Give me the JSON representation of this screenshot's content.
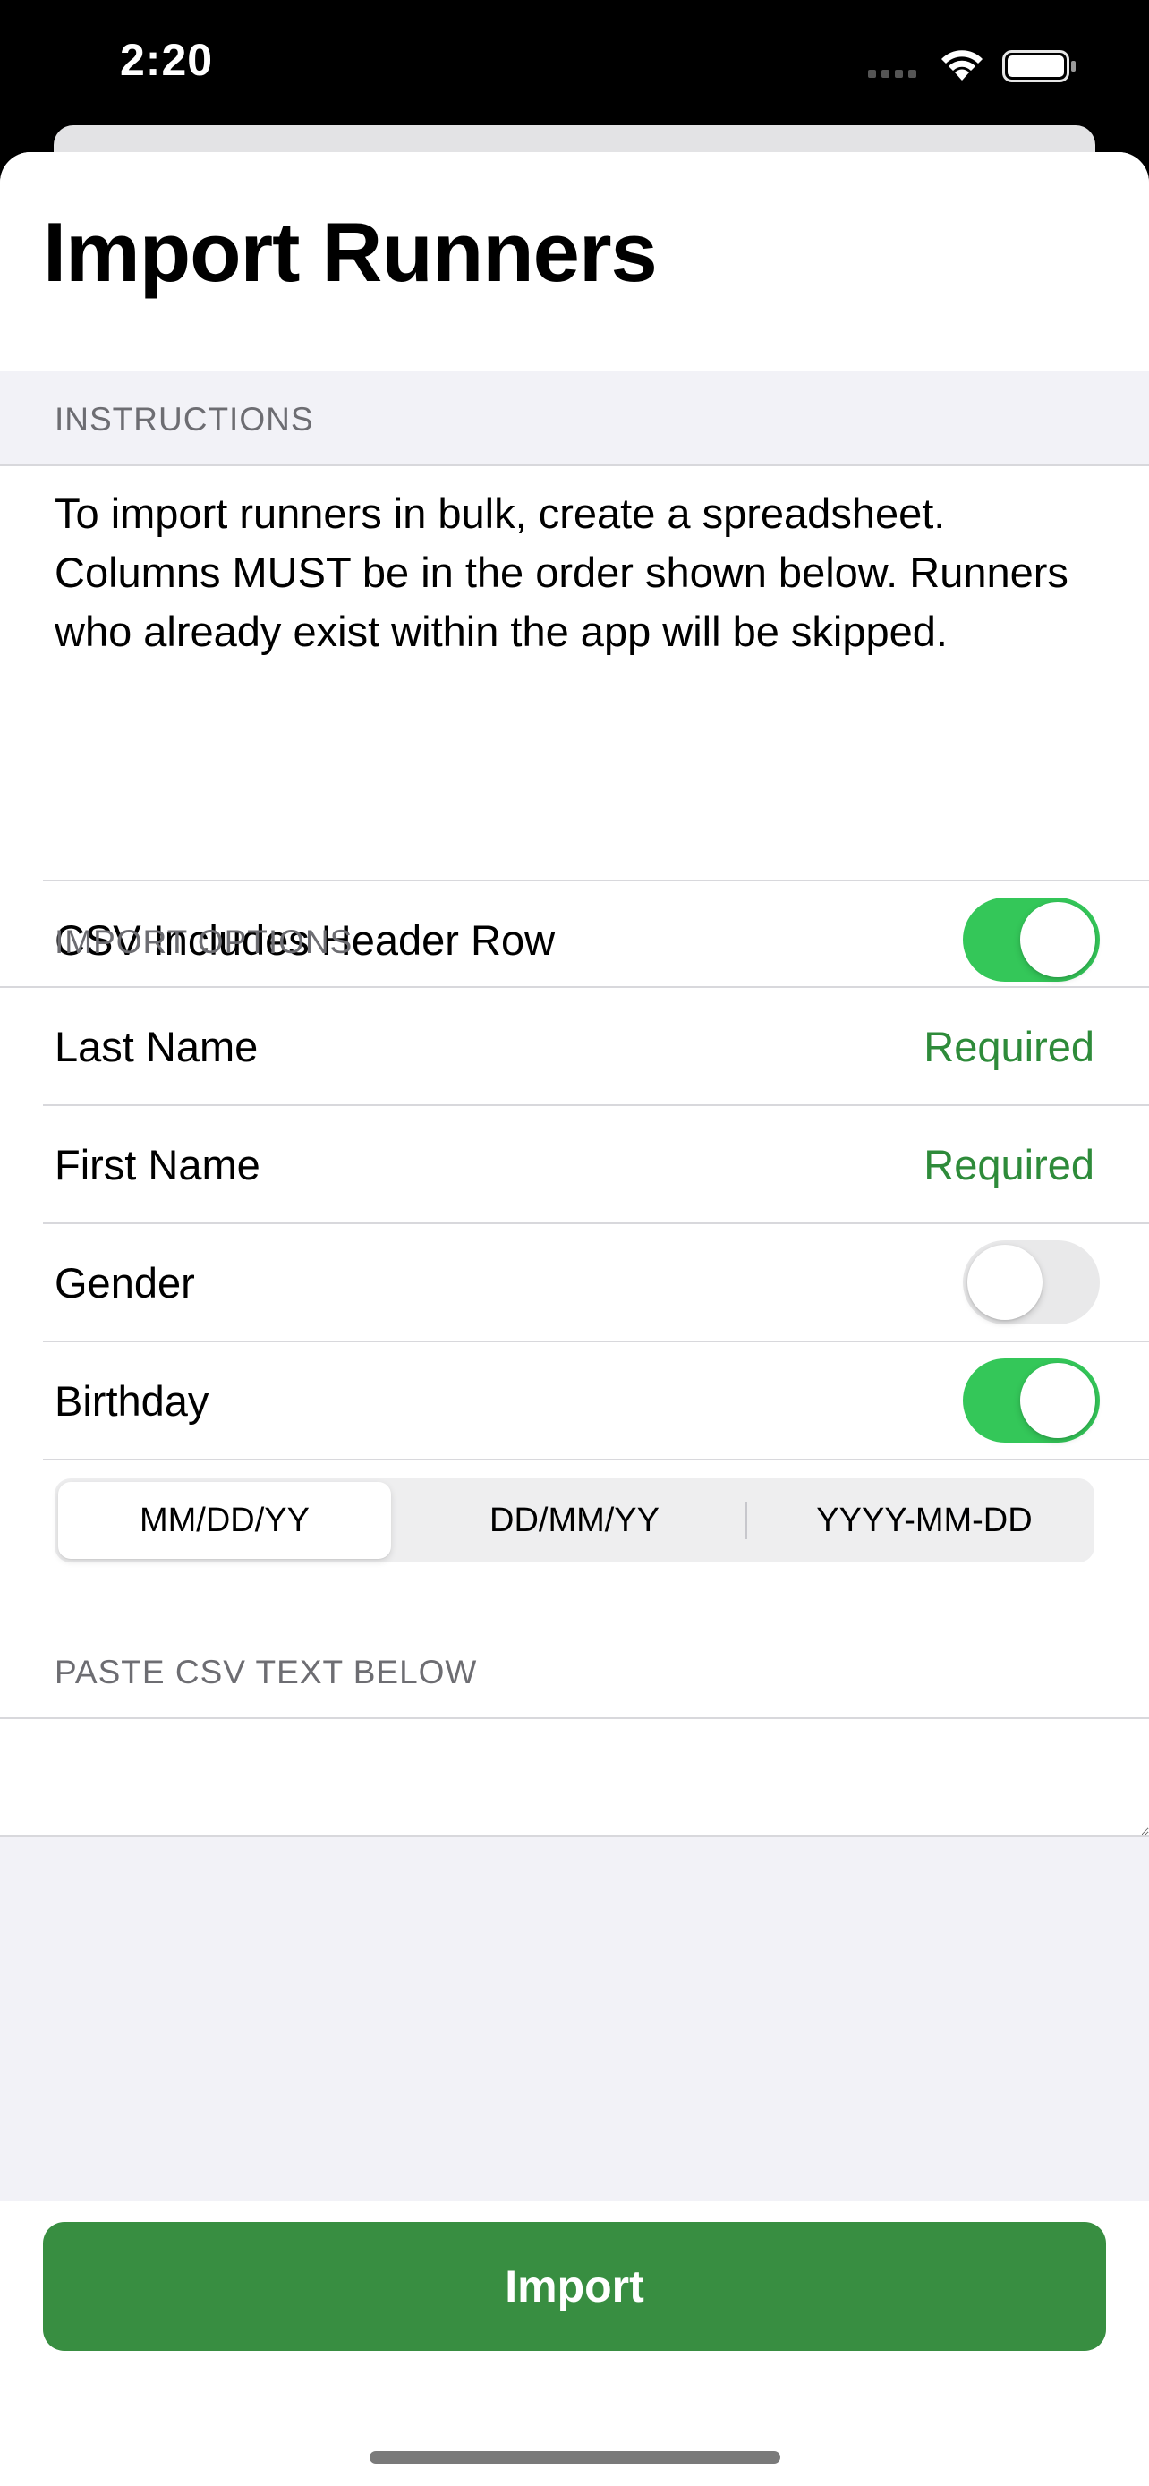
{
  "status_bar": {
    "time": "2:20"
  },
  "header": {
    "title": "Import Runners"
  },
  "instructions": {
    "section_label": "INSTRUCTIONS",
    "text": "To import runners in bulk, create a spreadsheet. Columns MUST be in the order shown below. Runners who already exist within the app will be skipped.",
    "header_row_label": "CSV Includes Header Row",
    "header_row_enabled": true
  },
  "import_options": {
    "section_label": "IMPORT OPTIONS",
    "last_name": {
      "label": "Last Name",
      "value": "Required"
    },
    "first_name": {
      "label": "First Name",
      "value": "Required"
    },
    "gender": {
      "label": "Gender",
      "enabled": false
    },
    "birthday": {
      "label": "Birthday",
      "enabled": true
    },
    "date_formats": [
      "MM/DD/YY",
      "DD/MM/YY",
      "YYYY-MM-DD"
    ],
    "selected_date_format": "MM/DD/YY"
  },
  "paste_csv": {
    "section_label": "PASTE CSV TEXT BELOW",
    "value": ""
  },
  "import_button": {
    "label": "Import"
  },
  "colors": {
    "accent_green": "#388e41",
    "toggle_on": "#34c759",
    "required_text": "#2e8b3a"
  }
}
